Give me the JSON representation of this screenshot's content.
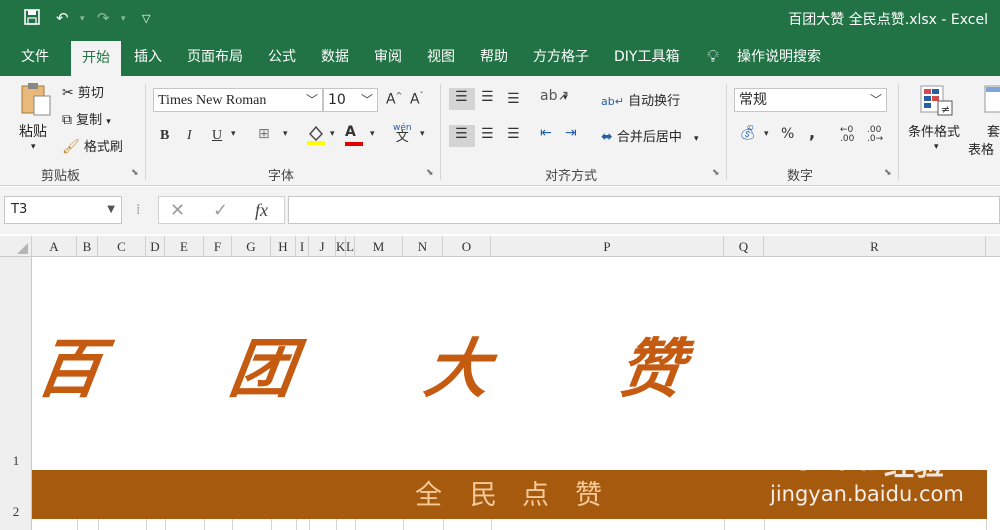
{
  "titlebar": {
    "save_icon": "save-icon",
    "undo_icon": "undo-icon",
    "redo_icon": "redo-icon",
    "customize_icon": "customize-qat-icon",
    "title": "百团大赞 全民点赞.xlsx  -  Excel"
  },
  "tabs": [
    "文件",
    "开始",
    "插入",
    "页面布局",
    "公式",
    "数据",
    "审阅",
    "视图",
    "帮助",
    "方方格子",
    "DIY工具箱"
  ],
  "active_tab": "开始",
  "tell_me": "操作说明搜索",
  "ribbon": {
    "clipboard": {
      "label": "剪贴板",
      "paste": "粘贴",
      "cut": "剪切",
      "copy": "复制",
      "format_painter": "格式刷"
    },
    "font": {
      "label": "字体",
      "font_name": "Times New Roman",
      "font_size": "10",
      "bold": "B",
      "italic": "I",
      "underline": "U",
      "font_color_letter": "A",
      "phonetic": "wén 文"
    },
    "alignment": {
      "label": "对齐方式",
      "wrap_text": "自动换行",
      "merge_center": "合并后居中"
    },
    "number": {
      "label": "数字",
      "format": "常规",
      "percent": "%",
      "comma": ",",
      "inc_decimal": ".00",
      "dec_decimal": ".0"
    },
    "styles": {
      "conditional_format": "条件格式",
      "format_table_1": "套",
      "format_table_2": "表格"
    }
  },
  "formula_bar": {
    "name_box": "T3",
    "cancel": "✕",
    "enter": "✓",
    "fx": "fx",
    "value": ""
  },
  "columns": [
    "A",
    "B",
    "C",
    "D",
    "E",
    "F",
    "G",
    "H",
    "I",
    "J",
    "K",
    "L",
    "M",
    "N",
    "O",
    "P",
    "Q",
    "R"
  ],
  "rows": [
    "1",
    "2"
  ],
  "cells": {
    "title_chars": [
      "百",
      "团",
      "大",
      "赞"
    ],
    "subtitle_chars": [
      "全",
      "民",
      "点",
      "赞"
    ]
  },
  "colors": {
    "excel_green": "#217346",
    "title_orange": "#c55a11",
    "banner_brown": "#a55a0d",
    "subtitle_peach": "#f5c99a"
  },
  "watermark": {
    "logo": "Bai",
    "logo_suffix": "du",
    "jingyan": "经验",
    "url": "jingyan.baidu.com"
  }
}
